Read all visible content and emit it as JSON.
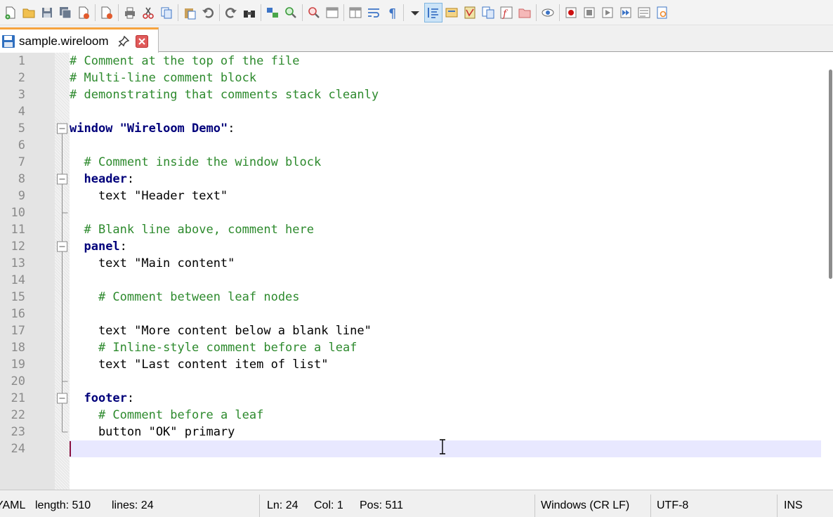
{
  "tabs": [
    {
      "name": "sample.wireloom",
      "active": true
    }
  ],
  "toolbar": {
    "icons": [
      "new-file",
      "open-file",
      "save",
      "save-all",
      "close",
      "close-all",
      "print",
      "cut",
      "copy",
      "paste",
      "undo",
      "redo",
      "find",
      "replace",
      "zoom-in",
      "zoom-out",
      "sync-vertical",
      "sync-horizontal",
      "word-wrap",
      "show-all-characters",
      "dropdown",
      "indent-guide",
      "user-defined-language",
      "document-map",
      "document-list",
      "function-list",
      "folder-workspace",
      "monitoring",
      "record-macro",
      "stop-recording",
      "playback",
      "run-macro-multiple",
      "save-macro",
      "spell-check"
    ],
    "active_icon": "indent-guide"
  },
  "editor": {
    "line_numbers": [
      "1",
      "2",
      "3",
      "4",
      "5",
      "6",
      "7",
      "8",
      "9",
      "10",
      "11",
      "12",
      "13",
      "14",
      "15",
      "16",
      "17",
      "18",
      "19",
      "20",
      "21",
      "22",
      "23",
      "24"
    ],
    "lines": [
      [
        {
          "t": "# Comment at the top of the file",
          "c": "comment"
        }
      ],
      [
        {
          "t": "# Multi-line comment block",
          "c": "comment"
        }
      ],
      [
        {
          "t": "# demonstrating that comments stack cleanly",
          "c": "comment"
        }
      ],
      [],
      [
        {
          "t": "window",
          "c": "key"
        },
        {
          "t": " ",
          "c": "str"
        },
        {
          "t": "\"Wireloom Demo\"",
          "c": "key"
        },
        {
          "t": ":",
          "c": "str"
        }
      ],
      [],
      [
        {
          "t": "  ",
          "c": "str"
        },
        {
          "t": "# Comment inside the window block",
          "c": "comment"
        }
      ],
      [
        {
          "t": "  ",
          "c": "str"
        },
        {
          "t": "header",
          "c": "key"
        },
        {
          "t": ":",
          "c": "str"
        }
      ],
      [
        {
          "t": "    text \"Header text\"",
          "c": "str"
        }
      ],
      [],
      [
        {
          "t": "  ",
          "c": "str"
        },
        {
          "t": "# Blank line above, comment here",
          "c": "comment"
        }
      ],
      [
        {
          "t": "  ",
          "c": "str"
        },
        {
          "t": "panel",
          "c": "key"
        },
        {
          "t": ":",
          "c": "str"
        }
      ],
      [
        {
          "t": "    text \"Main content\"",
          "c": "str"
        }
      ],
      [],
      [
        {
          "t": "    ",
          "c": "str"
        },
        {
          "t": "# Comment between leaf nodes",
          "c": "comment"
        }
      ],
      [],
      [
        {
          "t": "    text \"More content below a blank line\"",
          "c": "str"
        }
      ],
      [
        {
          "t": "    ",
          "c": "str"
        },
        {
          "t": "# Inline-style comment before a leaf",
          "c": "comment"
        }
      ],
      [
        {
          "t": "    text \"Last content item of list\"",
          "c": "str"
        }
      ],
      [],
      [
        {
          "t": "  ",
          "c": "str"
        },
        {
          "t": "footer",
          "c": "key"
        },
        {
          "t": ":",
          "c": "str"
        }
      ],
      [
        {
          "t": "    ",
          "c": "str"
        },
        {
          "t": "# Comment before a leaf",
          "c": "comment"
        }
      ],
      [
        {
          "t": "    button \"OK\" primary",
          "c": "str"
        }
      ],
      []
    ],
    "current_line": 24,
    "fold_markers": [
      5,
      8,
      12,
      21
    ]
  },
  "statusbar": {
    "language": "YAML",
    "length": "length: 510",
    "lines": "lines: 24",
    "ln": "Ln: 24",
    "col": "Col: 1",
    "pos": "Pos: 511",
    "eol": "Windows (CR LF)",
    "encoding": "UTF-8",
    "mode": "INS"
  },
  "colors": {
    "comment": "#2d8a2d",
    "keyword": "#00007a",
    "current_line": "#e8e8ff",
    "tab_accent": "#f6a33e"
  }
}
